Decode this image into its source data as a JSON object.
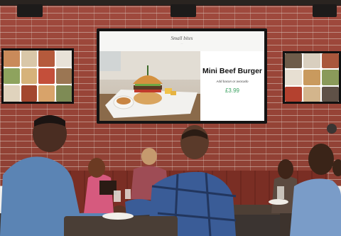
{
  "menu_screen": {
    "category": "Small bites",
    "subtitle": "...",
    "item_name": "Mini Beef Burger",
    "item_description": "Add bacon or avocado",
    "price": "£3.99",
    "price_color": "#3aa160"
  },
  "colors": {
    "brick": "#9a4538",
    "booth": "#7a2e24"
  }
}
